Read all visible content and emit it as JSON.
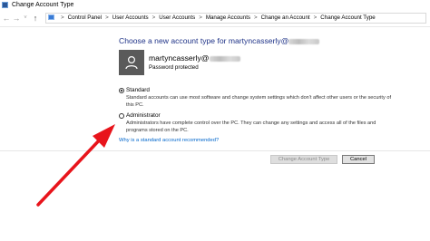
{
  "window": {
    "title": "Change Account Type"
  },
  "address_bar": {
    "back": "←",
    "forward": "→",
    "dropdown": "˅",
    "up": "↑",
    "breadcrumbs": [
      "Control Panel",
      "User Accounts",
      "User Accounts",
      "Manage Accounts",
      "Change an Account",
      "Change Account Type"
    ],
    "separator": ">"
  },
  "main": {
    "header_prefix": "Choose a new account type for martyncasserly@",
    "user": {
      "name": "martyncasserly@",
      "status": "Password protected"
    },
    "options": [
      {
        "label": "Standard",
        "checked": true,
        "description": "Standard accounts can use most software and change system settings which don't affect other users or the security of this PC."
      },
      {
        "label": "Administrator",
        "checked": false,
        "description": "Administrators have complete control over the PC. They can change any settings and access all of the files and programs stored on the PC."
      }
    ],
    "help_link": "Why is a standard account recommended?"
  },
  "buttons": {
    "change": "Change Account Type",
    "cancel": "Cancel"
  },
  "colors": {
    "header": "#1e3287",
    "link": "#0066cc",
    "annotation_arrow": "#e8141b",
    "avatar_bg": "#5a5a5a"
  }
}
